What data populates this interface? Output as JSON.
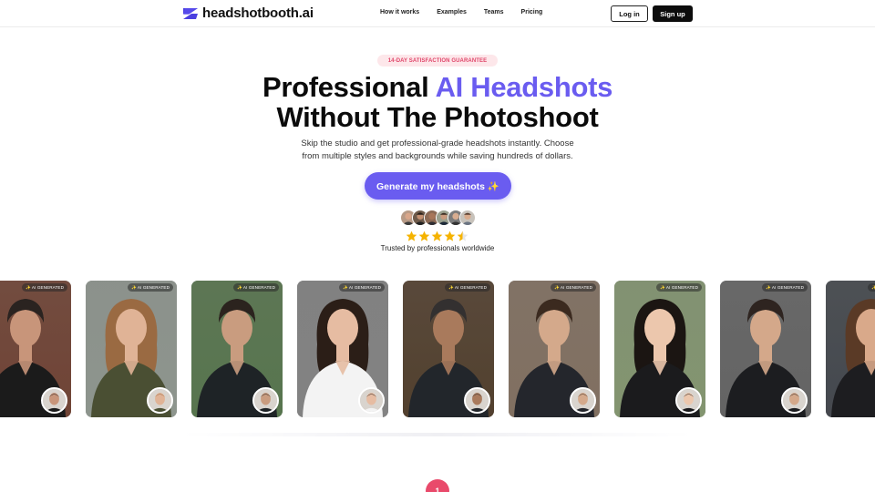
{
  "nav": {
    "brand": "headshotbooth.ai",
    "links": [
      "How it works",
      "Examples",
      "Teams",
      "Pricing"
    ],
    "login": "Log in",
    "signup": "Sign up"
  },
  "hero": {
    "badge": "14-DAY SATISFACTION GUARANTEE",
    "title_part1": "Professional ",
    "title_accent": "AI Headshots",
    "title_line2": "Without The Photoshoot",
    "subtitle_line1": "Skip the studio and get professional-grade headshots instantly. Choose",
    "subtitle_line2": "from multiple styles and backgrounds while saving hundreds of dollars.",
    "cta": "Generate my headshots ✨",
    "rating": 4.5,
    "trusted": "Trusted by professionals worldwide"
  },
  "carousel": {
    "tag": "✨ AI GENERATED",
    "cards": [
      {
        "name": "bearded-man-brick",
        "bg": "#7a4a3a",
        "skin": "#c8957a",
        "hair": "#2a2320",
        "outfit": "#1b1b1b"
      },
      {
        "name": "curly-woman-green",
        "bg": "#9aa29a",
        "skin": "#e0b396",
        "hair": "#9a6a42",
        "outfit": "#4a4f33"
      },
      {
        "name": "man-lake",
        "bg": "#5f7f55",
        "skin": "#c99c7f",
        "hair": "#2b231e",
        "outfit": "#1e2326"
      },
      {
        "name": "asian-woman-white",
        "bg": "#8e8e8e",
        "skin": "#e6bca2",
        "hair": "#2b1e17",
        "outfit": "#f3f3f3"
      },
      {
        "name": "man-bookshelf",
        "bg": "#5a4633",
        "skin": "#a97a5c",
        "hair": "#333030",
        "outfit": "#22262b"
      },
      {
        "name": "man-suit-street",
        "bg": "#8d7a6a",
        "skin": "#d4a98b",
        "hair": "#3b2a1f",
        "outfit": "#24262c"
      },
      {
        "name": "asian-woman-blazer",
        "bg": "#8fa27a",
        "skin": "#ecc7ad",
        "hair": "#1b1512",
        "outfit": "#1b1b1d"
      },
      {
        "name": "man-suit-gray",
        "bg": "#6d6d6d",
        "skin": "#d4a88a",
        "hair": "#2e2420",
        "outfit": "#1c1d20"
      },
      {
        "name": "woman-office",
        "bg": "#4b4f55",
        "skin": "#d9a98a",
        "hair": "#5a3a26",
        "outfit": "#1d1d20"
      }
    ]
  },
  "colors": {
    "accent": "#6a5cf0",
    "badge_text": "#e0466a",
    "badge_bg": "#fde7ea",
    "step_dot": "#e94a6b",
    "star": "#f5b300"
  },
  "step": "1"
}
